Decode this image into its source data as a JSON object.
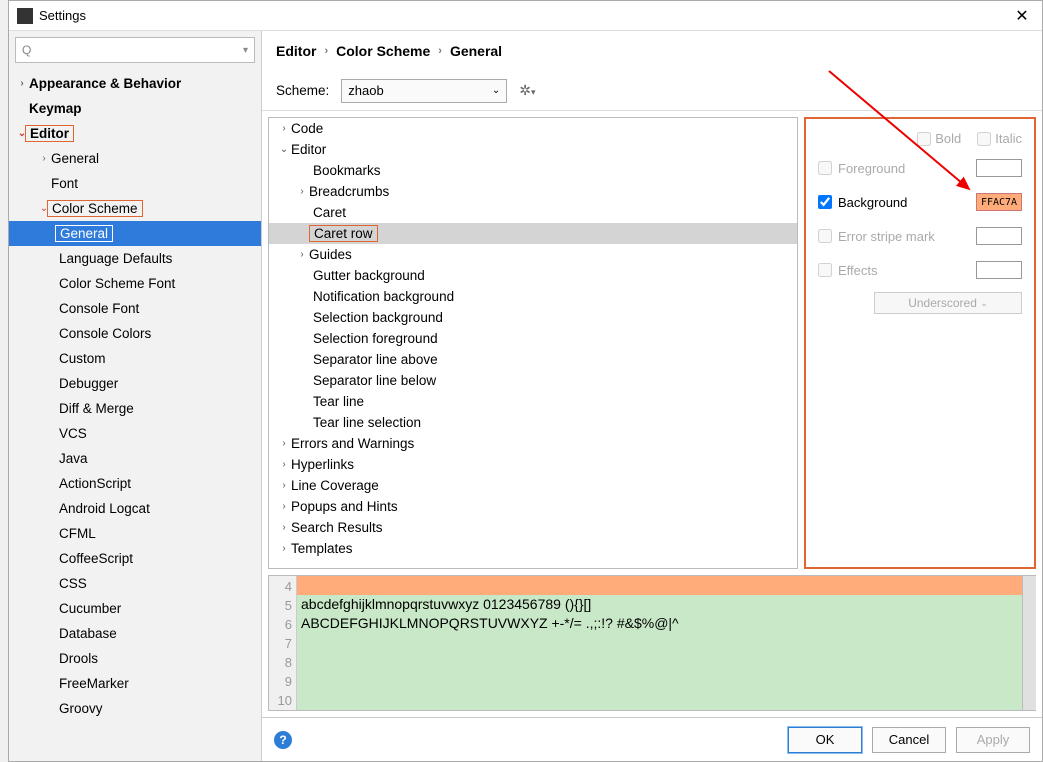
{
  "window": {
    "title": "Settings"
  },
  "search": {
    "placeholder": ""
  },
  "sidebar": {
    "appearance": "Appearance & Behavior",
    "keymap": "Keymap",
    "editor": "Editor",
    "general": "General",
    "font": "Font",
    "color_scheme": "Color Scheme",
    "items": [
      "General",
      "Language Defaults",
      "Color Scheme Font",
      "Console Font",
      "Console Colors",
      "Custom",
      "Debugger",
      "Diff & Merge",
      "VCS",
      "Java",
      "ActionScript",
      "Android Logcat",
      "CFML",
      "CoffeeScript",
      "CSS",
      "Cucumber",
      "Database",
      "Drools",
      "FreeMarker",
      "Groovy"
    ]
  },
  "breadcrumb": {
    "a": "Editor",
    "b": "Color Scheme",
    "c": "General"
  },
  "scheme": {
    "label": "Scheme:",
    "value": "zhaob"
  },
  "cat": {
    "code": "Code",
    "editor": "Editor",
    "editor_children": [
      "Bookmarks",
      "Breadcrumbs",
      "Caret",
      "Caret row",
      "Guides",
      "Gutter background",
      "Notification background",
      "Selection background",
      "Selection foreground",
      "Separator line above",
      "Separator line below",
      "Tear line",
      "Tear line selection"
    ],
    "rest": [
      "Errors and Warnings",
      "Hyperlinks",
      "Line Coverage",
      "Popups and Hints",
      "Search Results",
      "Templates"
    ]
  },
  "props": {
    "bold": "Bold",
    "italic": "Italic",
    "foreground": "Foreground",
    "background": "Background",
    "background_color": "FFAC7A",
    "error_stripe": "Error stripe mark",
    "effects": "Effects",
    "effect_type": "Underscored"
  },
  "preview": {
    "ln4": "4",
    "ln5": "5",
    "ln6": "6",
    "ln7": "7",
    "ln8": "8",
    "ln9": "9",
    "ln10": "10",
    "l5": "abcdefghijklmnopqrstuvwxyz 0123456789 (){}[]",
    "l6": "ABCDEFGHIJKLMNOPQRSTUVWXYZ +-*/= .,;:!? #&$%@|^"
  },
  "buttons": {
    "ok": "OK",
    "cancel": "Cancel",
    "apply": "Apply"
  }
}
